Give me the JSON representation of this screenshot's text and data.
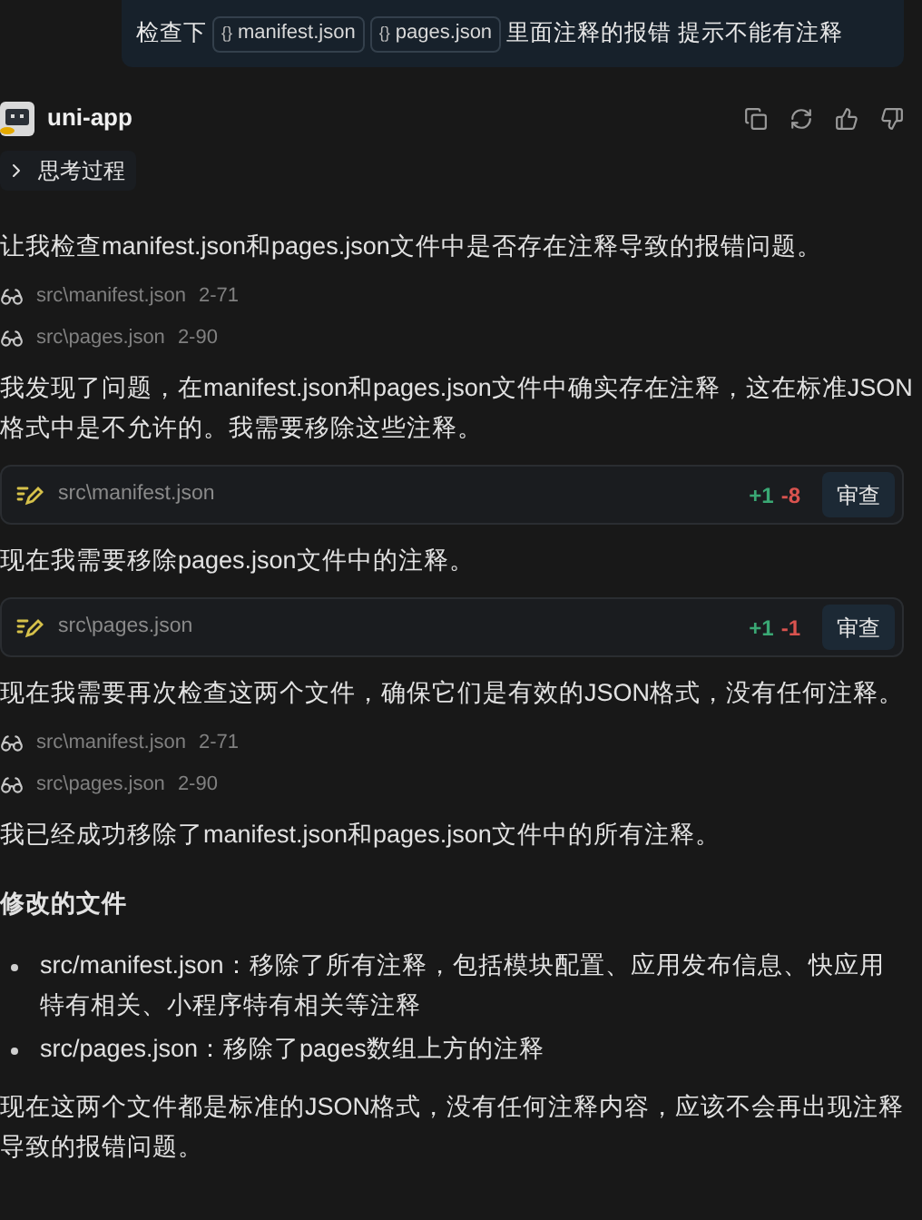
{
  "user_message": {
    "segments": [
      {
        "kind": "text",
        "text": "检查下"
      },
      {
        "kind": "file_chip",
        "icon": "{}",
        "text": "manifest.json"
      },
      {
        "kind": "file_chip",
        "icon": "{}",
        "text": "pages.json"
      },
      {
        "kind": "text",
        "text": "里面注释的报错 提示不能有注释"
      }
    ]
  },
  "assistant": {
    "name": "uni-app"
  },
  "thinking": {
    "label": "思考过程",
    "expanded": false
  },
  "blocks": [
    {
      "kind": "paragraph",
      "text": "让我检查manifest.json和pages.json文件中是否存在注释导致的报错问题。"
    },
    {
      "kind": "file_read",
      "path": "src\\manifest.json",
      "range": "2-71"
    },
    {
      "kind": "file_read",
      "path": "src\\pages.json",
      "range": "2-90"
    },
    {
      "kind": "paragraph",
      "text": "我发现了问题，在manifest.json和pages.json文件中确实存在注释，这在标准JSON格式中是不允许的。我需要移除这些注释。"
    },
    {
      "kind": "file_edit",
      "path": "src\\manifest.json",
      "added": "+1",
      "removed": "-8",
      "button": "审查"
    },
    {
      "kind": "paragraph",
      "text": "现在我需要移除pages.json文件中的注释。"
    },
    {
      "kind": "file_edit",
      "path": "src\\pages.json",
      "added": "+1",
      "removed": "-1",
      "button": "审查"
    },
    {
      "kind": "paragraph",
      "text": "现在我需要再次检查这两个文件，确保它们是有效的JSON格式，没有任何注释。"
    },
    {
      "kind": "file_read",
      "path": "src\\manifest.json",
      "range": "2-71"
    },
    {
      "kind": "file_read",
      "path": "src\\pages.json",
      "range": "2-90"
    },
    {
      "kind": "paragraph",
      "text": "我已经成功移除了manifest.json和pages.json文件中的所有注释。"
    },
    {
      "kind": "heading",
      "text": "修改的文件"
    },
    {
      "kind": "list",
      "items": [
        "src/manifest.json：移除了所有注释，包括模块配置、应用发布信息、快应用特有相关、小程序特有相关等注释",
        "src/pages.json：移除了pages数组上方的注释"
      ]
    },
    {
      "kind": "paragraph",
      "text": "现在这两个文件都是标准的JSON格式，没有任何注释内容，应该不会再出现注释导致的报错问题。"
    }
  ]
}
